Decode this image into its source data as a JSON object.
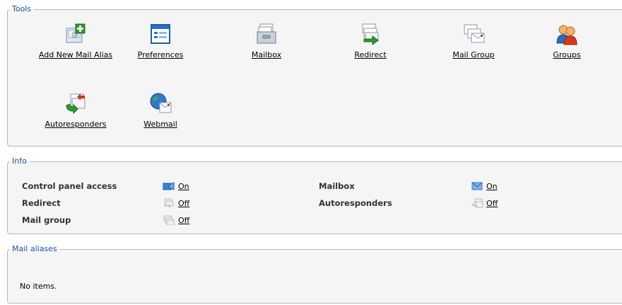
{
  "tools": {
    "legend": "Tools",
    "items": [
      {
        "label": "Add New Mail Alias",
        "icon": "add-mail-alias-icon"
      },
      {
        "label": "Preferences",
        "icon": "preferences-icon"
      },
      {
        "label": "Mailbox",
        "icon": "mailbox-icon"
      },
      {
        "label": "Redirect",
        "icon": "redirect-icon"
      },
      {
        "label": "Mail Group",
        "icon": "mail-group-icon"
      },
      {
        "label": "Groups",
        "icon": "groups-icon"
      },
      {
        "label": "Autoresponders",
        "icon": "autoresponders-icon"
      },
      {
        "label": "Webmail",
        "icon": "webmail-icon"
      }
    ]
  },
  "info": {
    "legend": "Info",
    "rows": [
      {
        "label": "Control panel access",
        "value": "On",
        "enabled": true
      },
      {
        "label": "Mailbox",
        "value": "On",
        "enabled": true
      },
      {
        "label": "Redirect",
        "value": "Off",
        "enabled": false
      },
      {
        "label": "Autoresponders",
        "value": "Off",
        "enabled": false
      },
      {
        "label": "Mail group",
        "value": "Off",
        "enabled": false
      }
    ]
  },
  "mail_aliases": {
    "legend": "Mail aliases",
    "empty_text": "No items."
  },
  "colors": {
    "legend": "#1c4fa8",
    "panel_bg": "#f5f5f5",
    "border": "#b7b7b7"
  }
}
